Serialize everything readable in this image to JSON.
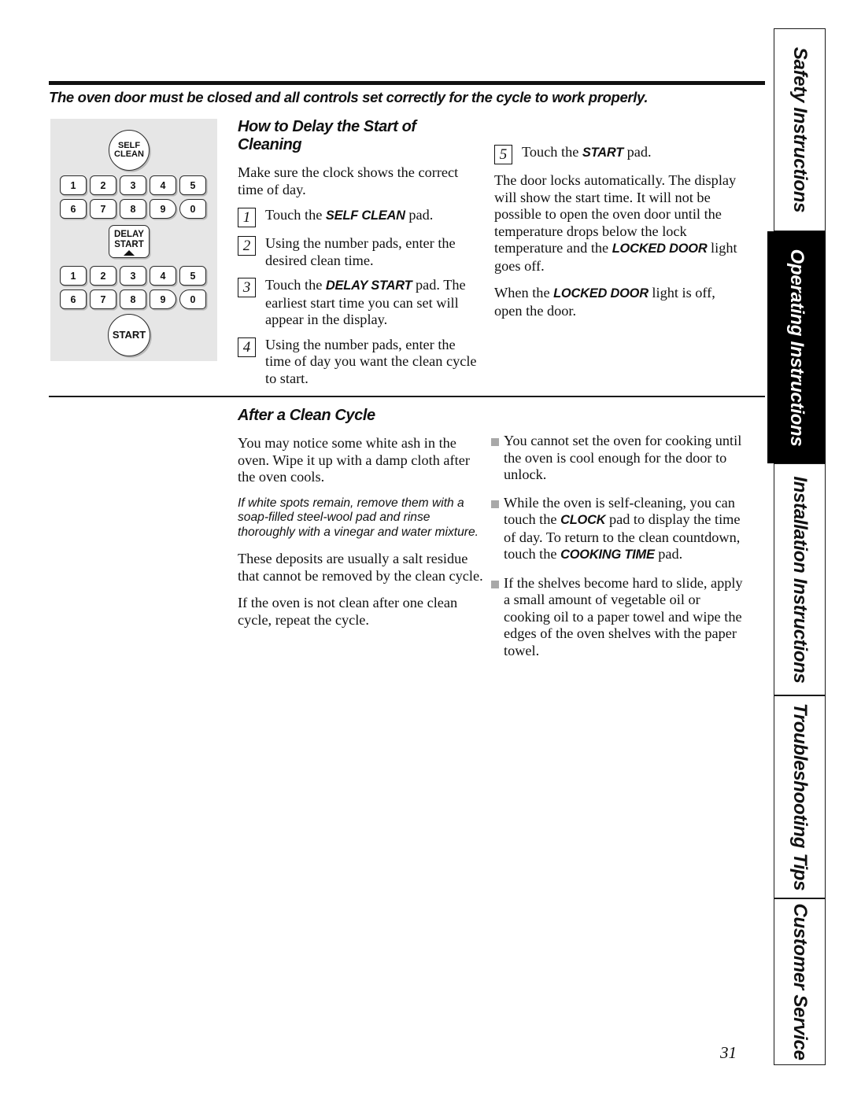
{
  "page": {
    "number": "31",
    "intro": "The oven door must be closed and all controls set correctly for the cycle to work properly."
  },
  "control_panel": {
    "self_clean_line1": "SELF",
    "self_clean_line2": "CLEAN",
    "delay_start_line1": "DELAY",
    "delay_start_line2": "START",
    "start_label": "START",
    "keypad_row1": [
      "1",
      "2",
      "3",
      "4",
      "5"
    ],
    "keypad_row2": [
      "6",
      "7",
      "8",
      "9",
      "0"
    ],
    "keypad2_row1": [
      "1",
      "2",
      "3",
      "4",
      "5"
    ],
    "keypad2_row2": [
      "6",
      "7",
      "8",
      "9",
      "0"
    ]
  },
  "delay_section": {
    "heading": "How to Delay the Start of Cleaning",
    "intro": "Make sure the clock shows the correct time of day.",
    "steps": [
      {
        "num": "1",
        "pre": "Touch the ",
        "cap": "SELF CLEAN",
        "post": " pad."
      },
      {
        "num": "2",
        "pre": "Using the number pads, enter the desired clean time.",
        "cap": "",
        "post": ""
      },
      {
        "num": "3",
        "pre": "Touch the ",
        "cap": "DELAY START",
        "post": " pad. The earliest start time you can set will appear in the display."
      },
      {
        "num": "4",
        "pre": "Using the number pads, enter the time of day you want the clean cycle to start.",
        "cap": "",
        "post": ""
      },
      {
        "num": "5",
        "pre": "Touch the ",
        "cap": "START",
        "post": " pad."
      }
    ],
    "para_lock_a": "The door locks automatically. The display will show the start time. It will not be possible to open the oven door until the temperature drops below the lock temperature and the ",
    "para_lock_cap": "LOCKED DOOR",
    "para_lock_b": " light goes off.",
    "para_open_a": "When the ",
    "para_open_cap": "LOCKED DOOR",
    "para_open_b": " light is off, open the door."
  },
  "after_section": {
    "heading": "After a Clean Cycle",
    "p1": "You may notice some white ash in the oven. Wipe it up with a damp cloth after the oven cools.",
    "note": "If white spots remain, remove them with a soap-filled steel-wool pad and rinse thoroughly with a vinegar and water mixture.",
    "p2": "These deposits are usually a salt residue that cannot be removed by the clean cycle.",
    "p3": "If the oven is not clean after one clean cycle, repeat the cycle.",
    "bullets": [
      {
        "a": "You cannot set the oven for cooking until the oven is cool enough for the door to unlock.",
        "cap1": "",
        "b": "",
        "cap2": "",
        "c": ""
      },
      {
        "a": "While the oven is self-cleaning, you can touch the ",
        "cap1": "CLOCK",
        "b": " pad to display the time of day. To return to the clean countdown, touch the ",
        "cap2": "COOKING TIME",
        "c": " pad."
      },
      {
        "a": "If the shelves become hard to slide, apply a small amount of vegetable oil or cooking oil to a paper towel and wipe the edges of the oven shelves with the paper towel.",
        "cap1": "",
        "b": "",
        "cap2": "",
        "c": ""
      }
    ]
  },
  "tabs": [
    {
      "label": "Safety Instructions",
      "active": false
    },
    {
      "label": "Operating Instructions",
      "active": true
    },
    {
      "label": "Installation Instructions",
      "active": false
    },
    {
      "label": "Troubleshooting Tips",
      "active": false
    },
    {
      "label": "Customer Service",
      "active": false
    }
  ]
}
